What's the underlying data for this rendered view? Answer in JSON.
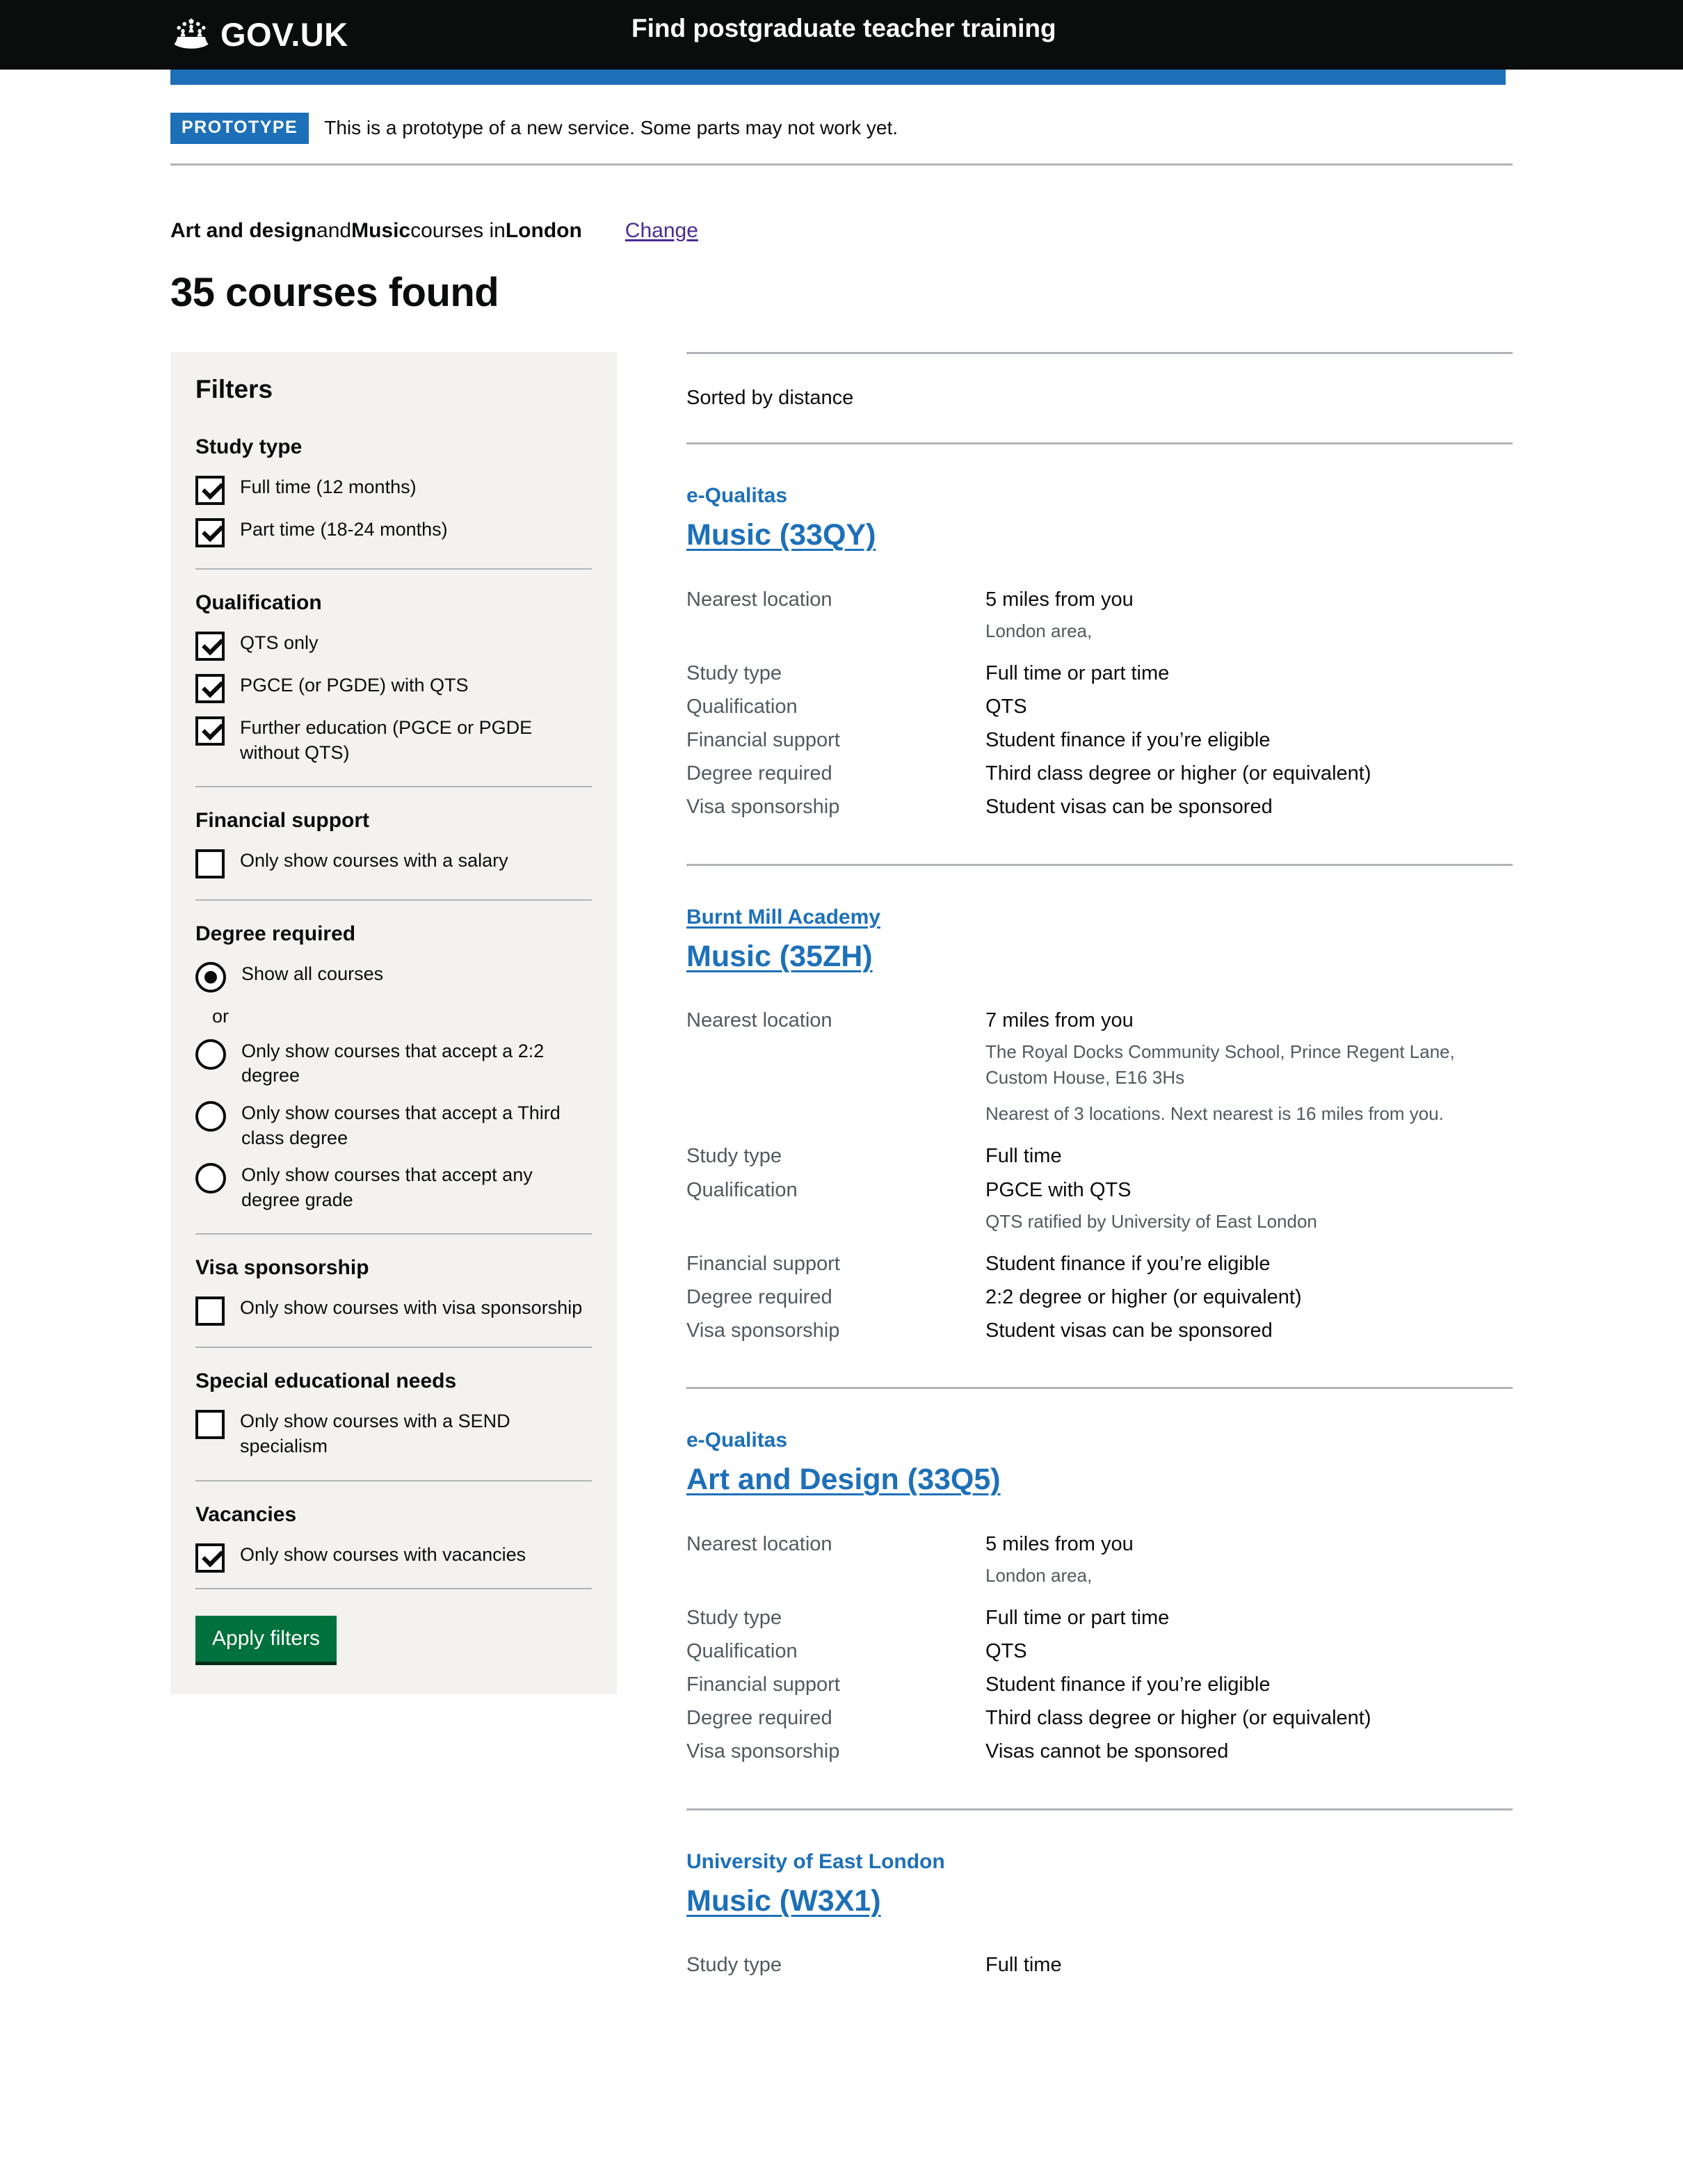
{
  "header": {
    "brand": "GOV.UK",
    "service_name": "Find postgraduate teacher training"
  },
  "phase_banner": {
    "tag": "PROTOTYPE",
    "text": "This is a prototype of a new service. Some parts may not work yet."
  },
  "search_summary": {
    "subject_one": "Art and design",
    "conjunction": " and ",
    "subject_two": "Music",
    "middle": " courses in ",
    "location": "London",
    "change_label": "Change"
  },
  "results_heading": "35 courses found",
  "filters": {
    "title": "Filters",
    "apply_label": "Apply filters",
    "or_label": "or",
    "groups": [
      {
        "legend": "Study type",
        "type": "checkbox",
        "options": [
          {
            "label": "Full time (12 months)",
            "checked": true
          },
          {
            "label": "Part time (18-24 months)",
            "checked": true
          }
        ]
      },
      {
        "legend": "Qualification",
        "type": "checkbox",
        "options": [
          {
            "label": "QTS only",
            "checked": true
          },
          {
            "label": "PGCE (or PGDE) with QTS",
            "checked": true
          },
          {
            "label": "Further education (PGCE or PGDE without QTS)",
            "checked": true
          }
        ]
      },
      {
        "legend": "Financial support",
        "type": "checkbox",
        "options": [
          {
            "label": "Only show courses with a salary",
            "checked": false
          }
        ]
      },
      {
        "legend": "Degree required",
        "type": "radio",
        "options": [
          {
            "label": "Show all courses",
            "checked": true
          },
          {
            "label": "Only show courses that accept a 2:2 degree",
            "checked": false
          },
          {
            "label": "Only show courses that accept a Third class degree",
            "checked": false
          },
          {
            "label": "Only show courses that accept any degree grade",
            "checked": false
          }
        ]
      },
      {
        "legend": "Visa sponsorship",
        "type": "checkbox",
        "options": [
          {
            "label": "Only show courses with visa sponsorship",
            "checked": false
          }
        ]
      },
      {
        "legend": "Special educational needs",
        "type": "checkbox",
        "options": [
          {
            "label": "Only show courses with a SEND specialism",
            "checked": false
          }
        ]
      },
      {
        "legend": "Vacancies",
        "type": "checkbox",
        "options": [
          {
            "label": "Only show courses with vacancies",
            "checked": true
          }
        ]
      }
    ]
  },
  "results": {
    "sort_text": "Sorted by distance",
    "labels": {
      "nearest_location": "Nearest location",
      "study_type": "Study type",
      "qualification": "Qualification",
      "financial_support": "Financial support",
      "degree_required": "Degree required",
      "visa_sponsorship": "Visa sponsorship"
    },
    "courses": [
      {
        "provider": "e-Qualitas",
        "provider_underlined": false,
        "title": "Music (33QY)",
        "nearest_location": "5 miles from you",
        "location_sub_1": "London area,",
        "location_sub_2": "",
        "study_type": "Full time or part time",
        "qualification": "QTS",
        "qualification_sub": "",
        "financial_support": "Student finance if you’re eligible",
        "degree_required": "Third class degree or higher (or equivalent)",
        "visa_sponsorship": "Student visas can be sponsored"
      },
      {
        "provider": "Burnt Mill Academy",
        "provider_underlined": true,
        "title": "Music (35ZH)",
        "nearest_location": "7 miles from you",
        "location_sub_1": "The Royal Docks Community School, Prince Regent Lane, Custom House, E16 3Hs",
        "location_sub_2": "Nearest of 3 locations. Next nearest is 16 miles from you.",
        "study_type": "Full time",
        "qualification": "PGCE with QTS",
        "qualification_sub": "QTS ratified by University of East London",
        "financial_support": "Student finance if you’re eligible",
        "degree_required": "2:2 degree or higher (or equivalent)",
        "visa_sponsorship": "Student visas can be sponsored"
      },
      {
        "provider": "e-Qualitas",
        "provider_underlined": false,
        "title": "Art and Design (33Q5)",
        "nearest_location": "5 miles from you",
        "location_sub_1": "London area,",
        "location_sub_2": "",
        "study_type": "Full time or part time",
        "qualification": "QTS",
        "qualification_sub": "",
        "financial_support": "Student finance if you’re eligible",
        "degree_required": "Third class degree or higher (or equivalent)",
        "visa_sponsorship": "Visas cannot be sponsored"
      },
      {
        "provider": "University of East London",
        "provider_underlined": false,
        "title": "Music (W3X1)",
        "nearest_location": "",
        "location_sub_1": "",
        "location_sub_2": "",
        "study_type": "Full time",
        "qualification": "",
        "qualification_sub": "",
        "financial_support": "",
        "degree_required": "",
        "visa_sponsorship": ""
      }
    ]
  }
}
